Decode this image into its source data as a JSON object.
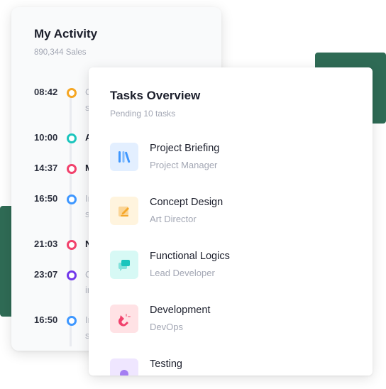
{
  "activity": {
    "title": "My Activity",
    "subtitle": "890,344 Sales",
    "items": [
      {
        "time": "08:42",
        "text": "C",
        "text2": "s",
        "dot_color": "#f5a623",
        "bold": false
      },
      {
        "time": "10:00",
        "text": "A",
        "text2": "",
        "dot_color": "#1bc5bd",
        "bold": true
      },
      {
        "time": "14:37",
        "text": "M",
        "text2": "",
        "dot_color": "#f1416c",
        "bold": true
      },
      {
        "time": "16:50",
        "text": "Ir",
        "text2": "s",
        "dot_color": "#3e97ff",
        "bold": false
      },
      {
        "time": "21:03",
        "text": "N",
        "text2": "",
        "dot_color": "#f1416c",
        "bold": true
      },
      {
        "time": "23:07",
        "text": "C",
        "text2": "ir",
        "dot_color": "#7239ea",
        "bold": false
      },
      {
        "time": "16:50",
        "text": "Ir",
        "text2": "s",
        "dot_color": "#3e97ff",
        "bold": false
      }
    ]
  },
  "tasks": {
    "title": "Tasks Overview",
    "subtitle": "Pending 10 tasks",
    "items": [
      {
        "title": "Project Briefing",
        "role": "Project Manager",
        "icon": "book-icon",
        "icon_bg": "#e3efff",
        "icon_color": "#3e97ff"
      },
      {
        "title": "Concept Design",
        "role": "Art Director",
        "icon": "pencil-edit-icon",
        "icon_bg": "#fff4de",
        "icon_color": "#f6a82b"
      },
      {
        "title": "Functional Logics",
        "role": "Lead Developer",
        "icon": "chat-icon",
        "icon_bg": "#d7f9f5",
        "icon_color": "#1bc5bd"
      },
      {
        "title": "Development",
        "role": "DevOps",
        "icon": "magnet-icon",
        "icon_bg": "#ffe2e5",
        "icon_color": "#f1416c"
      },
      {
        "title": "Testing",
        "role": "",
        "icon": "test-icon",
        "icon_bg": "#efe6ff",
        "icon_color": "#7239ea"
      }
    ]
  },
  "colors": {
    "accent_green": "#2f6b55"
  }
}
